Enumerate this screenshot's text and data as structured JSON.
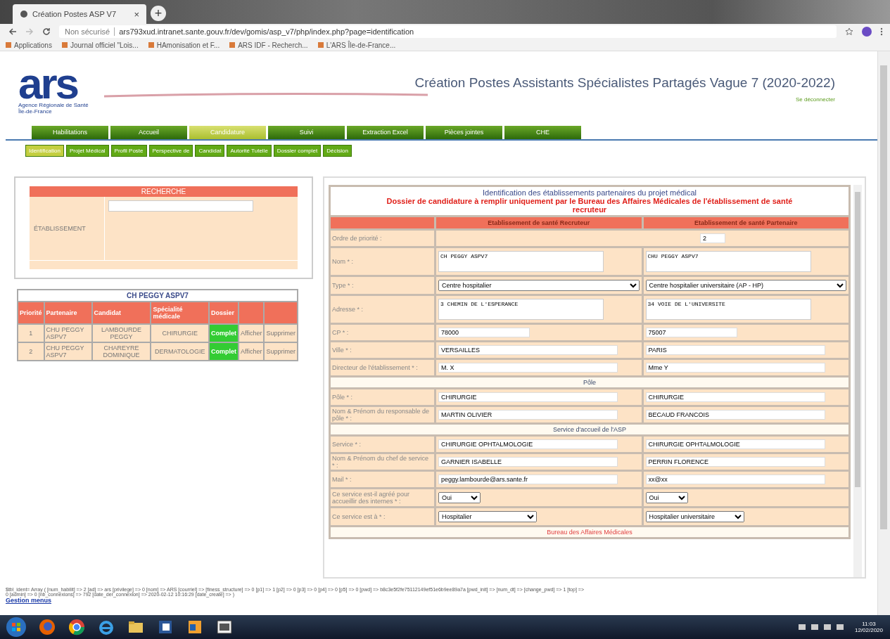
{
  "browser": {
    "tab_title": "Création Postes ASP V7",
    "tab_close": "×",
    "new_tab": "+",
    "security": "Non sécurisé",
    "url": "ars793xud.intranet.sante.gouv.fr/dev/gomis/asp_v7/php/index.php?page=identification",
    "bookmarks": [
      "Applications",
      "Journal officiel \"Lois...",
      "HAmonisation et F...",
      "ARS IDF - Recherch...",
      "L'ARS Île-de-France..."
    ]
  },
  "header": {
    "logo": "ars",
    "logo_subtitle": "Agence Régionale de Santé Île-de-France",
    "title": "Création Postes Assistants Spécialistes Partagés Vague 7 (2020-2022)",
    "logout": "Se déconnecter"
  },
  "nav": [
    {
      "label": "Habilitations",
      "selected": false
    },
    {
      "label": "Accueil",
      "selected": false
    },
    {
      "label": "Candidature",
      "selected": true
    },
    {
      "label": "Suivi",
      "selected": false
    },
    {
      "label": "Extraction Excel",
      "selected": false
    },
    {
      "label": "Pièces jointes",
      "selected": false
    },
    {
      "label": "CHE",
      "selected": false
    }
  ],
  "subnav": [
    {
      "label": "Identification",
      "selected": true
    },
    {
      "label": "Projet Médical",
      "selected": false
    },
    {
      "label": "Profil Poste",
      "selected": false
    },
    {
      "label": "Perspective de",
      "selected": false
    },
    {
      "label": "Candidat",
      "selected": false
    },
    {
      "label": "Autorité Tutelle",
      "selected": false
    },
    {
      "label": "Dossier complet",
      "selected": false
    },
    {
      "label": "Décision",
      "selected": false
    }
  ],
  "search": {
    "title": "RECHERCHE",
    "label": "ÉTABLISSEMENT"
  },
  "list": {
    "title": "CH PEGGY ASPV7",
    "columns": [
      "Priorité",
      "Partenaire",
      "Candidat",
      "Spécialité médicale",
      "Dossier"
    ],
    "rows": [
      {
        "priority": "1",
        "partner": "CHU PEGGY ASPV7",
        "candidate": "LAMBOURDE PEGGY",
        "specialty": "CHIRURGIE",
        "dossier": "Complet",
        "color": "#33cc33",
        "show": "Afficher",
        "delete": "Supprimer"
      },
      {
        "priority": "2",
        "partner": "CHU PEGGY ASPV7",
        "candidate": "CHAREYRE DOMINIQUE",
        "specialty": "DERMATOLOGIE",
        "dossier": "Complet",
        "color": "#33cc33",
        "show": "Afficher",
        "delete": "Supprimer"
      }
    ]
  },
  "form": {
    "title": "Identification des établissements partenaires du projet médical",
    "subtitle": "Dossier de candidature à remplir uniquement par le Bureau des Affaires Médicales de l'établissement de santé recruteur",
    "columns": [
      "Etablissement de santé Recruteur",
      "Etablissement de santé Partenaire"
    ],
    "rows": [
      {
        "kind": "single",
        "label": "Ordre de priorité :",
        "value": "2"
      },
      {
        "kind": "textarea",
        "label": "Nom * :",
        "values": [
          "CH PEGGY ASPV7",
          "CHU PEGGY ASPV7"
        ]
      },
      {
        "kind": "select",
        "label": "Type * :",
        "values": [
          "Centre hospitalier",
          "Centre hospitalier universitaire (AP - HP)"
        ]
      },
      {
        "kind": "textarea",
        "label": "Adresse * :",
        "values": [
          "3 CHEMIN DE L'ESPERANCE",
          "34 VOIE DE L'UNIVERSITE"
        ]
      },
      {
        "kind": "short",
        "label": "CP * :",
        "values": [
          "78000",
          "75007"
        ]
      },
      {
        "kind": "input",
        "label": "Ville * :",
        "values": [
          "VERSAILLES",
          "PARIS"
        ]
      },
      {
        "kind": "input",
        "label": "Directeur de l'établissement * :",
        "values": [
          "M. X",
          "Mme Y"
        ]
      },
      {
        "kind": "section",
        "label": "Pôle"
      },
      {
        "kind": "input",
        "label": "Pôle * :",
        "values": [
          "CHIRURGIE",
          "CHIRURGIE"
        ]
      },
      {
        "kind": "input",
        "label": "Nom & Prénom du responsable de pôle * :",
        "values": [
          "MARTIN OLIVIER",
          "BECAUD FRANCOIS"
        ]
      },
      {
        "kind": "section",
        "label": "Service d'accueil de l'ASP"
      },
      {
        "kind": "input",
        "label": "Service * :",
        "values": [
          "CHIRURGIE OPHTALMOLOGIE",
          "CHIRURGIE OPHTALMOLOGIE"
        ]
      },
      {
        "kind": "input",
        "label": "Nom & Prénom du chef de service * :",
        "values": [
          "GARNIER ISABELLE",
          "PERRIN FLORENCE"
        ]
      },
      {
        "kind": "input",
        "label": "Mail * :",
        "values": [
          "peggy.lambourde@ars.sante.fr",
          "xx@xx"
        ]
      },
      {
        "kind": "tiny",
        "label": "Ce service est-il agréé pour accueillir des internes * :",
        "values": [
          "Oui",
          "Oui"
        ]
      },
      {
        "kind": "small",
        "label": "Ce service est à * :",
        "values": [
          "Hospitalier",
          "Hospitalier universitaire"
        ]
      },
      {
        "kind": "alert",
        "label": "Bureau des Affaires Médicales"
      }
    ]
  },
  "debug": [
    "$tbl_ident= Array ( [num_habilit] => 2 [ad] => ars [privilege] => 0 [nom] => ARS [courriel] => [finess_structure] => 0 [p1] => 1 [p2] => 0 [p3] => 0 [p4] => 0 [p5] => 0 [pwd] => b8c3e5f2fe75112149ef51e6b9ee89a7a [pwd_init] => [num_dt] => [change_pwd] => 1 [top] =>",
    "0 [admin] => 0 [nb_connexions] => 792 [date_der_connexion] => 2020-02-12 10:16:29 [date_create] => )"
  ],
  "gestion": "Gestion menus",
  "taskbar": {
    "time": "11:03",
    "date": "12/02/2020"
  }
}
